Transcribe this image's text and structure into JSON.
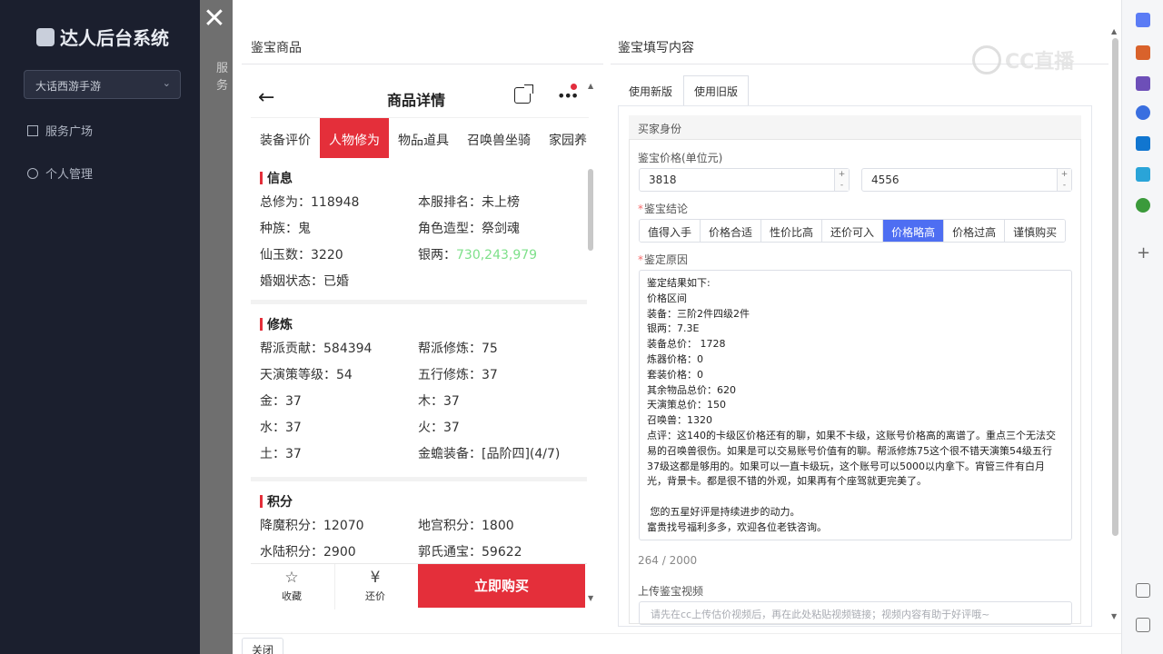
{
  "app": {
    "title": "达人后台系统",
    "game_select": "大话西游手游",
    "nav": [
      {
        "label": "服务广场",
        "icon": "building-icon"
      },
      {
        "label": "个人管理",
        "icon": "user-icon"
      }
    ],
    "bg_crumb": "服务"
  },
  "drawer": {
    "left_title": "鉴宝商品",
    "right_title": "鉴宝填写内容",
    "close_label": "关闭"
  },
  "phone": {
    "title": "商品详情",
    "tabs": [
      "装备评价",
      "人物修为",
      "物品道具",
      "召唤兽坐骑",
      "家园养"
    ],
    "active_tab": 1,
    "blocks": [
      {
        "title": "信息",
        "rows": [
          [
            "总修为：118948",
            "本服排名：未上榜"
          ],
          [
            "种族：鬼",
            "角色造型：祭剑魂"
          ],
          [
            "仙玉数：3220",
            "银两："
          ],
          [
            "婚姻状态：已婚",
            ""
          ]
        ],
        "silver_value": "730,243,979"
      },
      {
        "title": "修炼",
        "rows": [
          [
            "帮派贡献：584394",
            "帮派修炼：75"
          ],
          [
            "天演策等级：54",
            "五行修炼：37"
          ],
          [
            "金：37",
            "木：37"
          ],
          [
            "水：37",
            "火：37"
          ],
          [
            "土：37",
            "金蟾装备：[品阶四](4/7)"
          ]
        ]
      },
      {
        "title": "积分",
        "rows": [
          [
            "降魔积分：12070",
            "地宫积分：1800"
          ],
          [
            "水陆积分：2900",
            "郭氏通宝：59622"
          ]
        ]
      }
    ],
    "footer": {
      "favorite": "收藏",
      "bargain": "还价",
      "buy": "立即购买"
    }
  },
  "form": {
    "tabs": [
      "使用新版",
      "使用旧版"
    ],
    "active_tab": 1,
    "section_title": "买家身份",
    "price_label": "鉴宝价格(单位元)",
    "price_min": "3818",
    "price_max": "4556",
    "conclusion_label": "鉴宝结论",
    "conclusion_options": [
      "值得入手",
      "价格合适",
      "性价比高",
      "还价可入",
      "价格略高",
      "价格过高",
      "谨慎购买"
    ],
    "conclusion_selected": 4,
    "reason_label": "鉴定原因",
    "reason_text": "鉴定结果如下:\n价格区间\n装备：三阶2件四级2件\n银两：7.3E\n装备总价： 1728\n炼器价格：0\n套装价格：0\n其余物品总价：620\n天演策总价：150\n召唤兽：1320\n点评：这140的卡级区价格还有的聊，如果不卡级，这账号价格高的离谱了。重点三个无法交易的召唤兽很伤。如果是可以交易账号价值有的聊。帮派修炼75这个很不错天演策54级五行37级这都是够用的。如果可以一直卡级玩，这个账号可以5000以内拿下。宵管三件有白月光，背景卡。都是很不错的外观，如果再有个座驾就更完美了。\n\n 您的五星好评是持续进步的动力。\n富贵找号福利多多，欢迎各位老铁咨询。",
    "reason_count": "264 / 2000",
    "video_label": "上传鉴宝视频",
    "video_placeholder": "请先在cc上传估价视频后，再在此处粘贴视频链接；视频内容有助于好评哦~"
  },
  "watermark": "CC直播"
}
